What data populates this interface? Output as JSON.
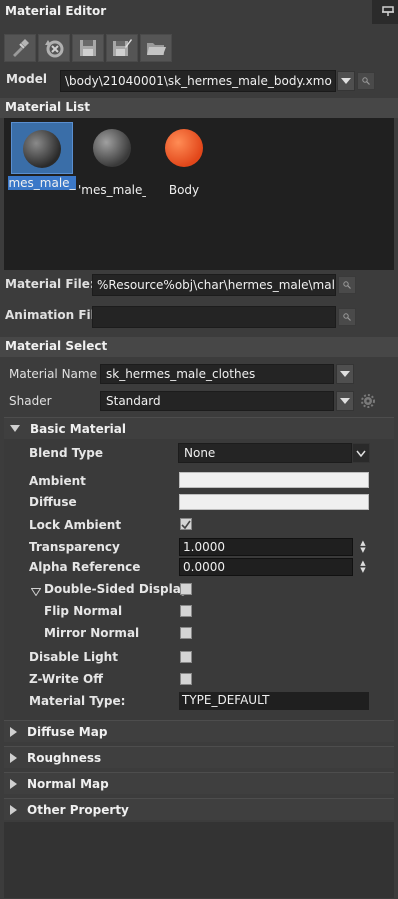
{
  "window": {
    "title": "Material Editor"
  },
  "toolbar": {
    "buttons": [
      {
        "icon": "eyedropper-icon"
      },
      {
        "icon": "reset-icon"
      },
      {
        "icon": "save-icon"
      },
      {
        "icon": "save-as-icon"
      },
      {
        "icon": "open-folder-icon"
      }
    ]
  },
  "model": {
    "label": "Model",
    "value": "\\body\\21040001\\sk_hermes_male_body.xmo"
  },
  "material_list": {
    "header": "Material List",
    "items": [
      {
        "caption": "mes_male_",
        "color": "#5a5a5a",
        "selected": true
      },
      {
        "caption": "'mes_male_",
        "color": "#6a6a6a",
        "selected": false
      },
      {
        "caption": "Body",
        "color": "#f05a28",
        "selected": false
      }
    ]
  },
  "files": {
    "material_label": "Material File:",
    "material_value": "%Resource%obj\\char\\hermes_male\\mal",
    "animation_label": "Animation File:",
    "animation_value": ""
  },
  "material_select": {
    "header": "Material Select",
    "name_label": "Material Name",
    "name_value": "sk_hermes_male_clothes",
    "shader_label": "Shader",
    "shader_value": "Standard"
  },
  "basic_material": {
    "header": "Basic Material",
    "blend_type_label": "Blend Type",
    "blend_type_value": "None",
    "ambient_label": "Ambient",
    "diffuse_label": "Diffuse",
    "lock_ambient_label": "Lock Ambient",
    "lock_ambient_checked": true,
    "transparency_label": "Transparency",
    "transparency_value": "1.0000",
    "alpha_reference_label": "Alpha Reference",
    "alpha_reference_value": "0.0000",
    "double_sided_label": "Double-Sided Display",
    "flip_normal_label": "Flip Normal",
    "mirror_normal_label": "Mirror Normal",
    "disable_light_label": "Disable Light",
    "zwrite_off_label": "Z-Write Off",
    "material_type_label": "Material Type:",
    "material_type_value": "TYPE_DEFAULT"
  },
  "groups": [
    {
      "label": "Diffuse Map"
    },
    {
      "label": "Roughness"
    },
    {
      "label": "Normal Map"
    },
    {
      "label": "Other Property"
    }
  ],
  "colors": {
    "accent": "#3b78c8",
    "panel": "#3c3c3c",
    "field": "#242424"
  }
}
